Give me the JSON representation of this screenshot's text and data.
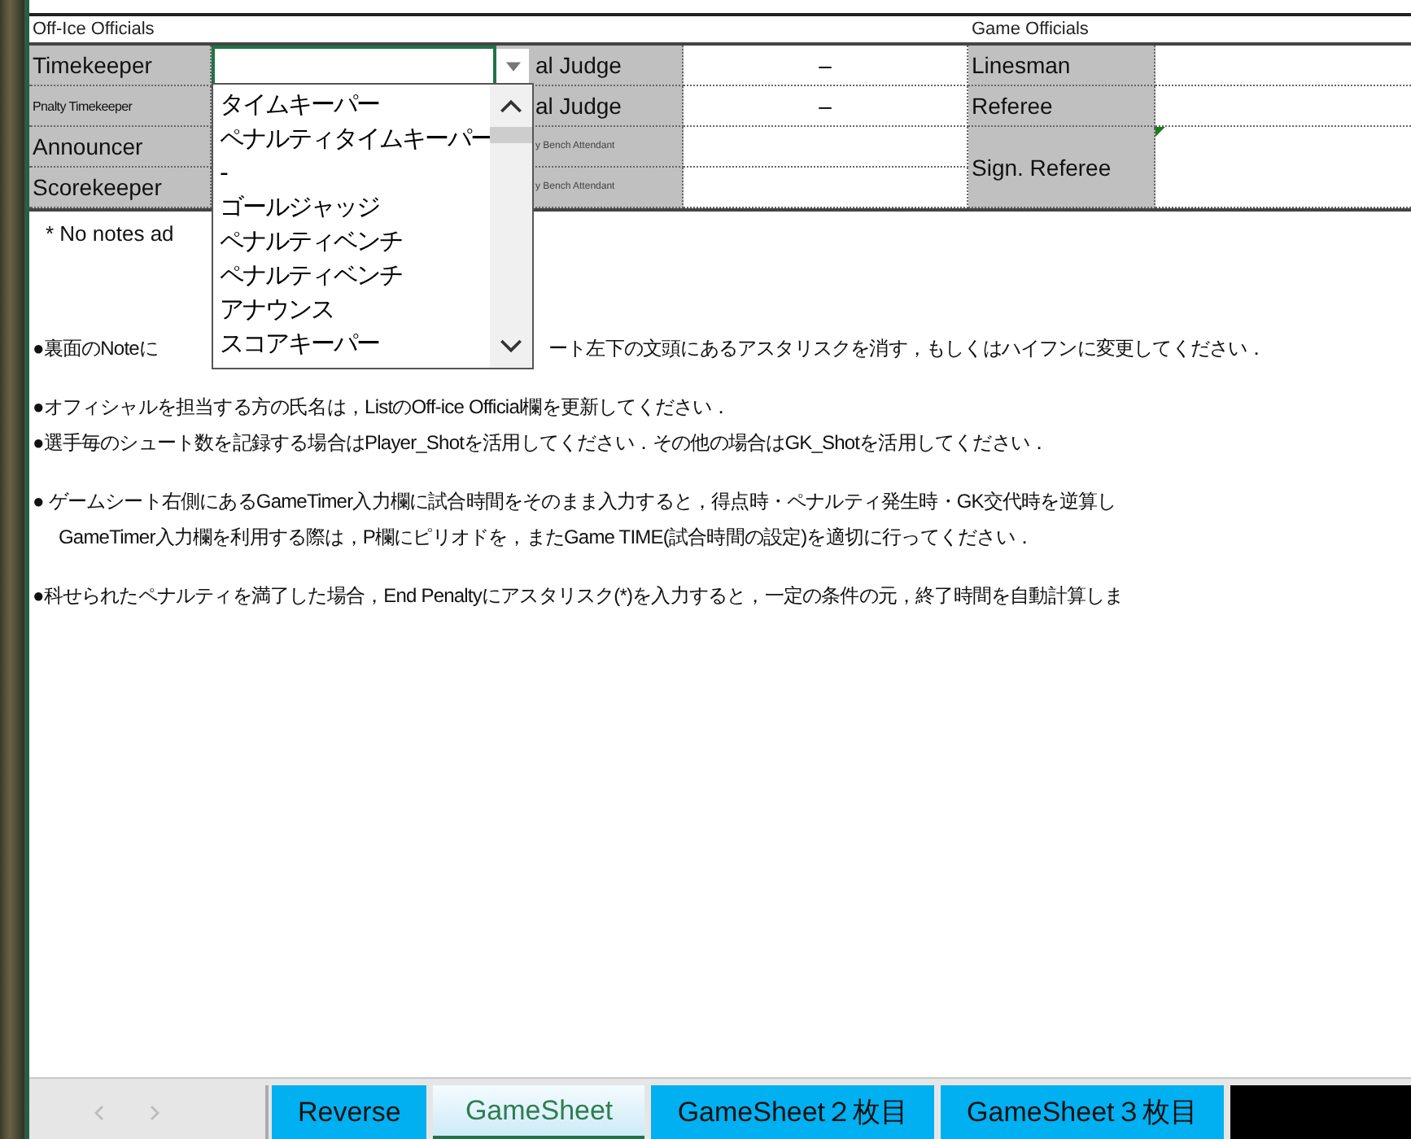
{
  "off_ice_header": "Off-Ice Officials",
  "game_officials_header": "Game Officials",
  "rows": [
    {
      "label": "Timekeeper",
      "kind": "normal",
      "judge": "al Judge",
      "judge_small": false,
      "value": "–",
      "official": "Linesman"
    },
    {
      "label": "Pnalty Timekeeper",
      "kind": "small",
      "judge": "al Judge",
      "judge_small": false,
      "value": "–",
      "official": "Referee"
    },
    {
      "label": "Announcer",
      "kind": "normal",
      "judge": "y Bench Attendant",
      "judge_small": true,
      "official": "Sign. Referee"
    },
    {
      "label": "Scorekeeper",
      "kind": "normal",
      "judge": "y Bench Attendant",
      "judge_small": true
    }
  ],
  "dropdown": {
    "options": [
      {
        "label": "タイムキーパー"
      },
      {
        "label": "ペナルティタイムキーパー"
      },
      {
        "label": "-"
      },
      {
        "label": "ゴールジャッジ"
      },
      {
        "label": "ペナルティベンチ"
      },
      {
        "label": "ペナルティベンチ"
      },
      {
        "label": "アナウンス"
      },
      {
        "label": "スコアキーパー"
      }
    ]
  },
  "note": "*   No notes ad",
  "paragraph_groups": [
    [
      {
        "lines": [
          [
            "●裏面のNoteに",
            "ート左下の文頭にあるアスタリスクを消す，もしくはハイフンに変更してください．"
          ]
        ]
      }
    ],
    [
      {
        "lines": [
          [
            "●オフィシャルを担当する方の氏名は，ListのOff-ice Official欄を更新してください．"
          ]
        ]
      },
      {
        "lines": [
          [
            "●選手毎のシュート数を記録する場合はPlayer_Shotを活用してください．その他の場合はGK_Shotを活用してください．"
          ]
        ]
      }
    ],
    [
      {
        "lines": [
          [
            "● ゲームシート右側にあるGameTimer入力欄に試合時間をそのまま入力すると，得点時・ペナルティ発生時・GK交代時を逆算し"
          ],
          [
            "GameTimer入力欄を利用する際は，P欄にピリオドを，またGame TIME(試合時間の設定)を適切に行ってください．"
          ]
        ]
      }
    ],
    [
      {
        "lines": [
          [
            "●科せられたペナルティを満了した場合，End Penaltyにアスタリスク(*)を入力すると，一定の条件の元，終了時間を自動計算しま"
          ]
        ]
      }
    ]
  ],
  "tabs": [
    {
      "label": "Reverse",
      "selected": false,
      "color": "#00b0f0"
    },
    {
      "label": "GameSheet",
      "selected": true
    },
    {
      "label": "GameSheet２枚目",
      "selected": false,
      "color": "#00b0f0"
    },
    {
      "label": "GameSheet３枚目",
      "selected": false,
      "color": "#00b0f0"
    },
    {
      "selected": false,
      "color": "#000000"
    }
  ]
}
